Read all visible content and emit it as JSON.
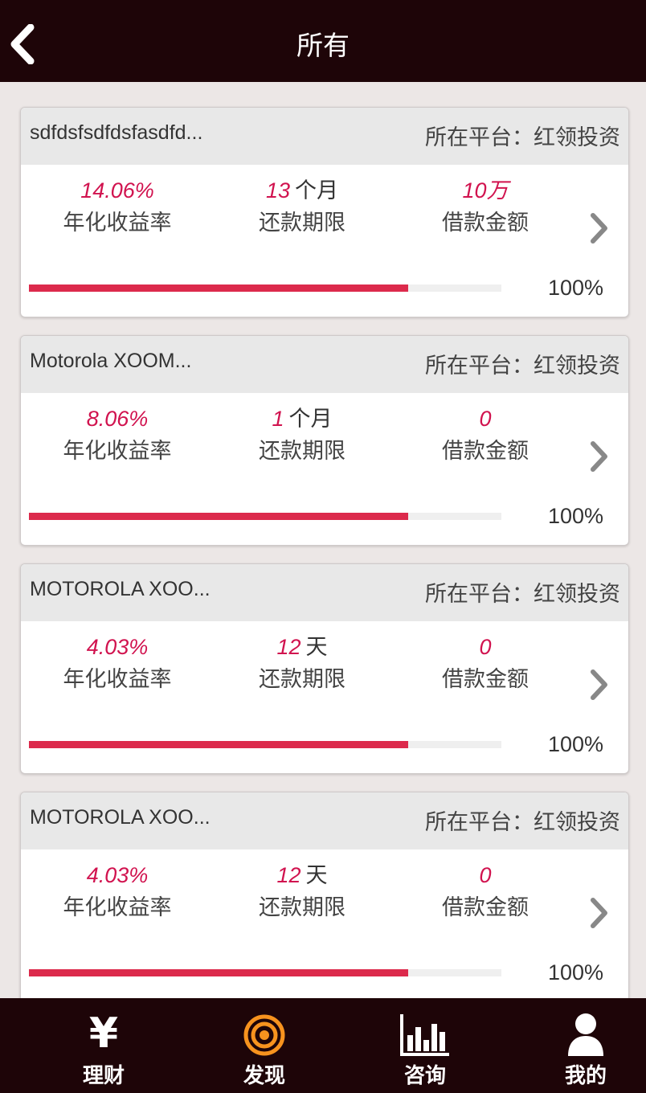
{
  "header": {
    "title": "所有"
  },
  "cards": [
    {
      "name": "sdfdsfsdfdsfasdfd...",
      "platform": "所在平台：红领投资",
      "rate": {
        "value": "14.06%",
        "label": "年化收益率"
      },
      "term": {
        "value": "13",
        "unit": "个月",
        "label": "还款期限"
      },
      "amount": {
        "value": "10万",
        "label": "借款金额"
      },
      "progress_fraction": 0.803,
      "progress_text": "100%"
    },
    {
      "name": "Motorola XOOM...",
      "platform": "所在平台：红领投资",
      "rate": {
        "value": "8.06%",
        "label": "年化收益率"
      },
      "term": {
        "value": "1",
        "unit": "个月",
        "label": "还款期限"
      },
      "amount": {
        "value": "0",
        "label": "借款金额"
      },
      "progress_fraction": 0.803,
      "progress_text": "100%"
    },
    {
      "name": "MOTOROLA XOO...",
      "platform": "所在平台：红领投资",
      "rate": {
        "value": "4.03%",
        "label": "年化收益率"
      },
      "term": {
        "value": "12",
        "unit": "天",
        "label": "还款期限"
      },
      "amount": {
        "value": "0",
        "label": "借款金额"
      },
      "progress_fraction": 0.803,
      "progress_text": "100%"
    },
    {
      "name": "MOTOROLA XOO...",
      "platform": "所在平台：红领投资",
      "rate": {
        "value": "4.03%",
        "label": "年化收益率"
      },
      "term": {
        "value": "12",
        "unit": "天",
        "label": "还款期限"
      },
      "amount": {
        "value": "0",
        "label": "借款金额"
      },
      "progress_fraction": 0.803,
      "progress_text": "100%"
    }
  ],
  "tabbar": {
    "tabs": [
      {
        "label": "理财",
        "icon": "yen-icon",
        "active": false
      },
      {
        "label": "发现",
        "icon": "target-icon",
        "active": true
      },
      {
        "label": "咨询",
        "icon": "bar-chart-icon",
        "active": false
      },
      {
        "label": "我的",
        "icon": "user-icon",
        "active": false
      }
    ],
    "yen_glyph": "¥"
  },
  "colors": {
    "header_bg": "#1e0508",
    "accent_red": "#d1134f",
    "progress_red": "#dc2a4c",
    "active_tab_orange": "#f7931e",
    "page_bg": "#ece7e6"
  }
}
